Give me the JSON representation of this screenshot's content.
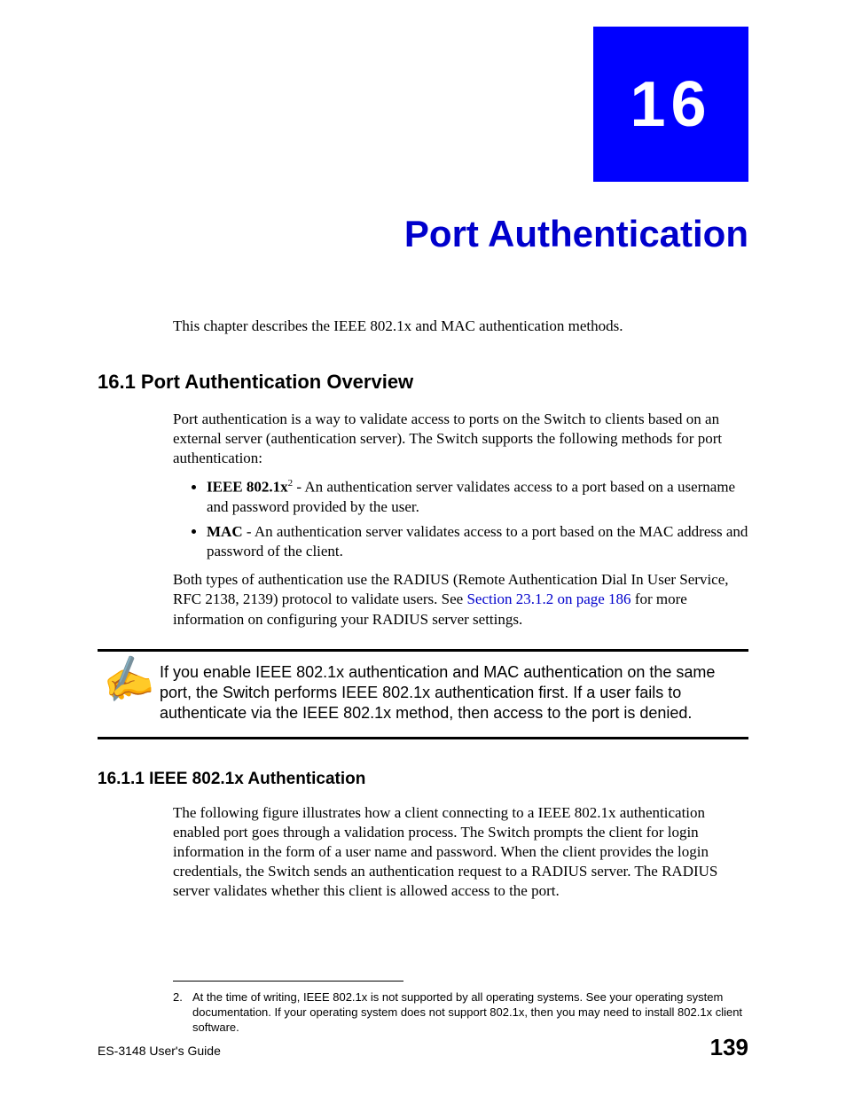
{
  "chapter_number": "16",
  "chapter_title": "Port Authentication",
  "intro_text": "This chapter describes the IEEE 802.1x and MAC authentication methods.",
  "section_1": {
    "heading": "16.1  Port Authentication Overview",
    "para_1": "Port authentication is a way to validate access to ports on the Switch to clients based on an external server (authentication server). The Switch supports the following methods for port authentication:",
    "bullet_1_strong": "IEEE 802.1x",
    "bullet_1_sup": "2",
    "bullet_1_rest": " - An authentication server validates access to a port based on a username and password provided by the user.",
    "bullet_2_strong": "MAC",
    "bullet_2_rest": " - An authentication server validates access to a port based on the MAC address and password of the client.",
    "para_2a": "Both types of authentication use the RADIUS (Remote Authentication Dial In User Service, RFC 2138, 2139) protocol to validate users. See ",
    "para_2_link": "Section 23.1.2 on page 186",
    "para_2b": " for more information on configuring your RADIUS server settings."
  },
  "note_icon": "✍",
  "note_text": "If you enable IEEE 802.1x authentication and MAC authentication on the same port, the Switch performs IEEE 802.1x authentication first. If a user fails to authenticate via the IEEE 802.1x method, then access to the port is denied.",
  "section_1_1": {
    "heading": "16.1.1  IEEE 802.1x Authentication",
    "para_1": "The following figure illustrates how a client connecting to a IEEE 802.1x authentication enabled port goes through a validation process. The Switch prompts the client for login information in the form of a user name and password. When the client provides the login credentials, the Switch sends an authentication request to a RADIUS server. The RADIUS server validates whether this client is allowed access to the port."
  },
  "footnote": {
    "num": "2.",
    "text": "At the time of writing, IEEE 802.1x is not supported by all operating systems. See your operating system documentation. If your operating system does not support 802.1x, then you may need to install 802.1x client software."
  },
  "footer": {
    "left": "ES-3148 User's Guide",
    "right": "139"
  }
}
